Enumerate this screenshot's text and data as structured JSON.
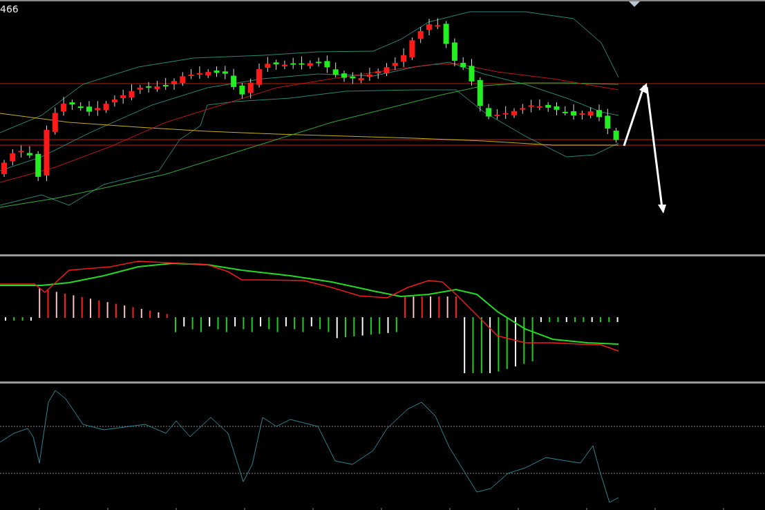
{
  "price_panel": {
    "label": "466"
  }
}
